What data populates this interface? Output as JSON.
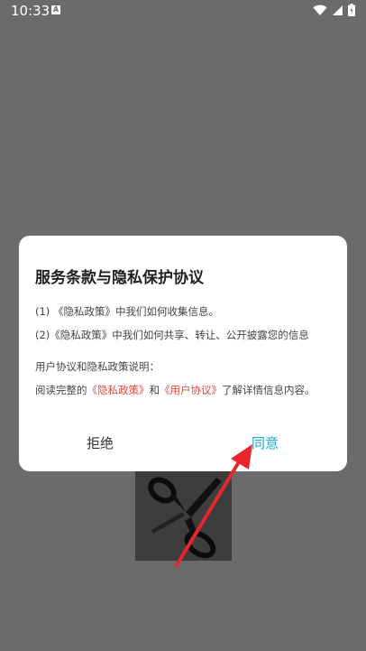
{
  "status_bar": {
    "time": "10:33",
    "app_icon": "A"
  },
  "dialog": {
    "title": "服务条款与隐私保护协议",
    "item1": "(1) 《隐私政策》中我们如何收集信息。",
    "item2": "(2)《隐私政策》中我们如何共享、转让、公开披露您的信息",
    "section_label": "用户协议和隐私政策说明：",
    "body_prefix": "阅读完整的",
    "privacy_link": "《隐私政策》",
    "body_and": "和",
    "user_link": "《用户协议》",
    "body_suffix": "了解详情信息内容。",
    "reject_label": "拒绝",
    "agree_label": "同意"
  },
  "colors": {
    "accent": "#19a6d8",
    "link": "#e0493e",
    "annotation_arrow": "#e8262d"
  }
}
